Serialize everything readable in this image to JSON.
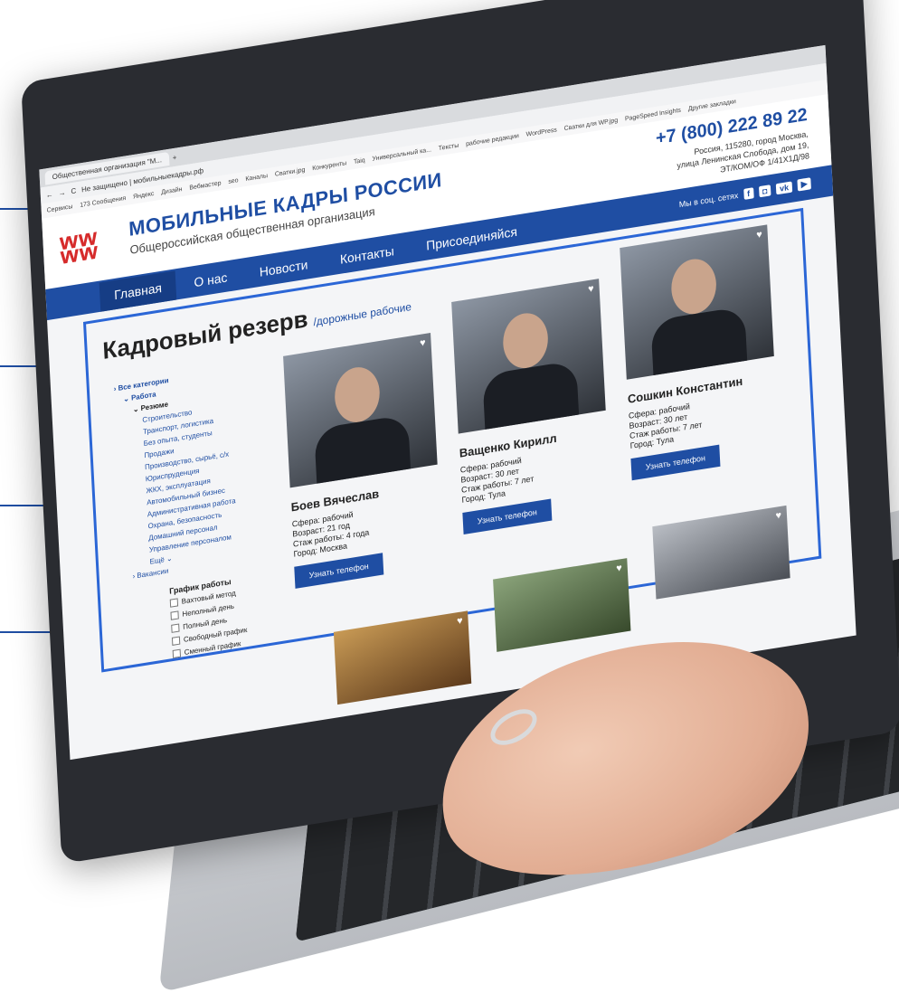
{
  "browser": {
    "tab_title": "Общественная организация \"М...",
    "address": "Не защищено | мобильныекадры.рф",
    "bookmarks": [
      "Сервисы",
      "173 Сообщения",
      "Яндекс",
      "Дизайн",
      "Вебмастер",
      "seo",
      "Каналы",
      "Сватки.jpg",
      "Конкуренты",
      "Taiq",
      "Универсальный ка...",
      "Тексты",
      "рабочие редакции",
      "WordPress",
      "Сватки для WP.jpg",
      "PageSpeed Insights",
      "Другие закладки"
    ]
  },
  "site": {
    "brand": "МОБИЛЬНЫЕ КАДРЫ РОССИИ",
    "tagline": "Общероссийская общественная организация",
    "phone": "+7 (800) 222 89 22",
    "address_line1": "Россия, 115280, город Москва,",
    "address_line2": "улица Ленинская Слобода, дом 19,",
    "address_line3": "ЭТ/КОМ/ОФ 1/41Х1Д/98",
    "social_label": "Мы в соц. сетях",
    "social_icons": [
      "facebook-icon",
      "instagram-icon",
      "vk-icon",
      "youtube-icon"
    ]
  },
  "nav": {
    "items": [
      "Главная",
      "О нас",
      "Новости",
      "Контакты",
      "Присоединяйся"
    ],
    "active": "Главная"
  },
  "page": {
    "title": "Кадровый резерв",
    "subtitle": "/дорожные рабочие"
  },
  "sidebar": {
    "all": "› Все категории",
    "work": "⌄ Работа",
    "resume": "⌄ Резюме",
    "categories": [
      "Строительство",
      "Транспорт, логистика",
      "Без опыта, студенты",
      "Продажи",
      "Производство, сырьё, с/х",
      "Юриспруденция",
      "ЖКХ, эксплуатация",
      "Автомобильный бизнес",
      "Административная работа",
      "Охрана, безопасность",
      "Домашний персонал",
      "Управление персоналом"
    ],
    "more": "Ещё ⌄",
    "vacancies": "› Вакансии"
  },
  "schedule": {
    "title": "График работы",
    "options": [
      "Вахтовый метод",
      "Неполный день",
      "Полный день",
      "Свободный график",
      "Сменный график"
    ]
  },
  "cards": [
    {
      "name": "Боев Вячеслав",
      "sphere": "Сфера: рабочий",
      "age": "Возраст: 21 год",
      "experience": "Стаж работы: 4 года",
      "city": "Город: Москва",
      "button": "Узнать телефон"
    },
    {
      "name": "Ващенко Кирилл",
      "sphere": "Сфера: рабочий",
      "age": "Возраст: 30 лет",
      "experience": "Стаж работы: 7 лет",
      "city": "Город: Тула",
      "button": "Узнать телефон"
    },
    {
      "name": "Сошкин Константин",
      "sphere": "Сфера: рабочий",
      "age": "Возраст: 30 лет",
      "experience": "Стаж работы: 7 лет",
      "city": "Город: Тула",
      "button": "Узнать телефон"
    }
  ],
  "colors": {
    "brand_blue": "#1f4ea3",
    "frame_blue": "#2b66d6",
    "logo_red": "#d62b2b"
  }
}
